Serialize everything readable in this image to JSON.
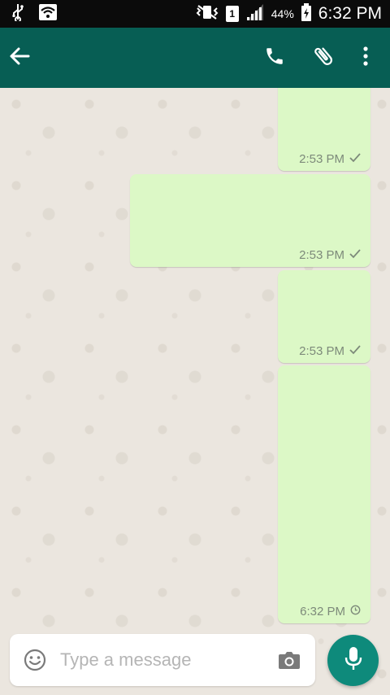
{
  "status_bar": {
    "sim_label": "1",
    "battery": "44%",
    "time": "6:32 PM"
  },
  "header": {
    "icons": [
      "back-arrow-icon",
      "phone-icon",
      "paperclip-icon",
      "more-vert-icon"
    ]
  },
  "messages": [
    {
      "time": "2:53 PM",
      "status": "sent"
    },
    {
      "time": "2:53 PM",
      "status": "sent"
    },
    {
      "time": "2:53 PM",
      "status": "sent"
    },
    {
      "time": "6:32 PM",
      "status": "pending"
    }
  ],
  "composer": {
    "placeholder": "Type a message"
  },
  "colors": {
    "header": "#075e54",
    "bubble_outgoing": "#dcf8c6",
    "mic_button": "#0e8a7b",
    "status_bar": "#0b0b0b"
  }
}
